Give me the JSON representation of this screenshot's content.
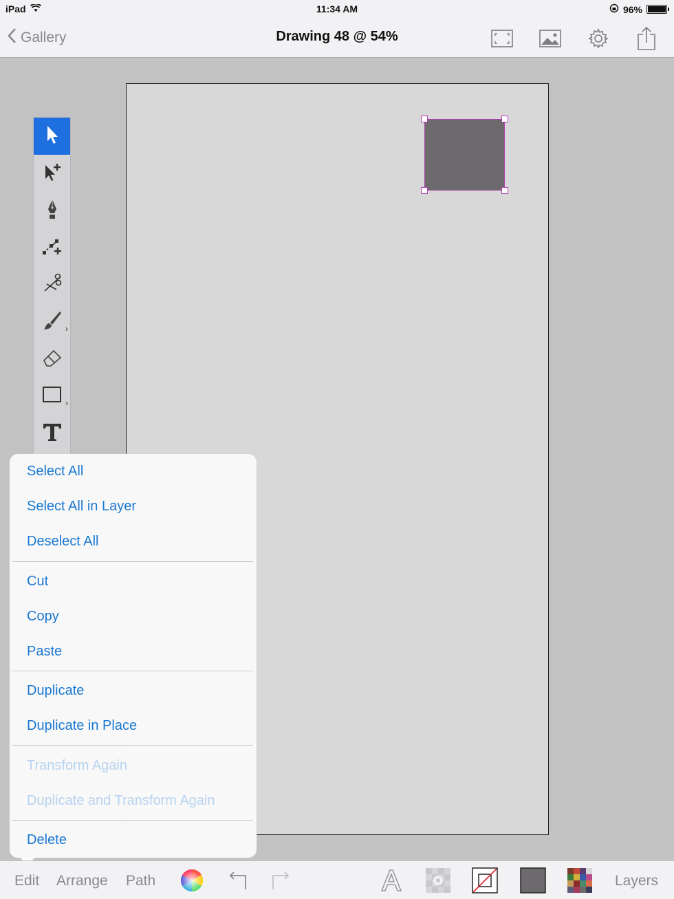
{
  "status": {
    "device": "iPad",
    "time": "11:34 AM",
    "battery": "96%"
  },
  "nav": {
    "back_label": "Gallery",
    "title": "Drawing 48 @ 54%"
  },
  "menu": {
    "items": [
      {
        "label": "Select All"
      },
      {
        "label": "Select All in Layer"
      },
      {
        "label": "Deselect All"
      },
      {
        "label": "Cut"
      },
      {
        "label": "Copy"
      },
      {
        "label": "Paste"
      },
      {
        "label": "Duplicate"
      },
      {
        "label": "Duplicate in Place"
      },
      {
        "label": "Transform Again"
      },
      {
        "label": "Duplicate and Transform Again"
      },
      {
        "label": "Delete"
      }
    ]
  },
  "bottombar": {
    "edit": "Edit",
    "arrange": "Arrange",
    "path": "Path",
    "layers": "Layers"
  },
  "colors": {
    "shape_fill": "#6c6a6c",
    "selection": "#b13fb2",
    "accent": "#1a78d2",
    "tool_active": "#1e6fe0"
  }
}
